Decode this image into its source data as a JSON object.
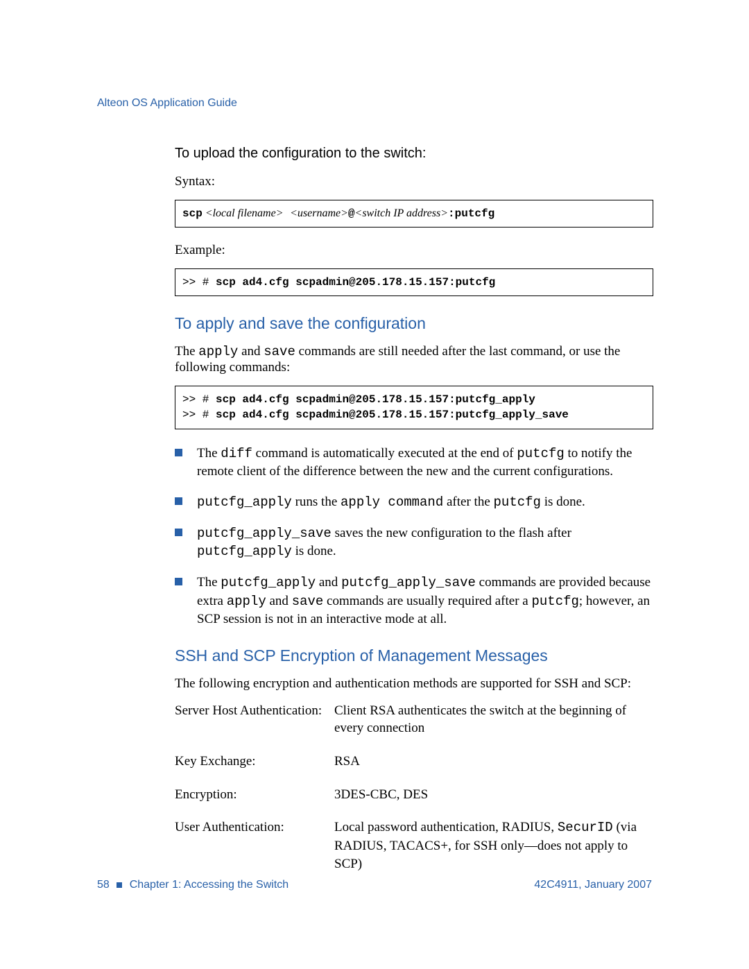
{
  "header": {
    "title": "Alteon OS Application Guide"
  },
  "main": {
    "step_title": "To upload the configuration to the switch:",
    "syntax_label": "Syntax:",
    "syntax_box": {
      "cmd": "scp",
      "param_local": " <local filename>",
      "sep1": " ",
      "param_user": "<username>",
      "at": "@",
      "param_ip": "<switch IP address>",
      "suffix": ":putcfg"
    },
    "example_label": "Example:",
    "example_box": {
      "prompt": ">> # ",
      "line": "scp ad4.cfg scpadmin@205.178.15.157:putcfg"
    },
    "apply_heading": "To apply and save the configuration",
    "apply_intro_a": "The ",
    "apply_intro_cmd1": "apply",
    "apply_intro_b": " and ",
    "apply_intro_cmd2": "save",
    "apply_intro_c": " commands are still needed after the last command, or use the following commands:",
    "apply_box": {
      "p1": ">> # ",
      "l1": "scp ad4.cfg scpadmin@205.178.15.157:putcfg_apply",
      "p2": ">> # ",
      "l2": "scp ad4.cfg scpadmin@205.178.15.157:putcfg_apply_save"
    },
    "bullets": {
      "b1_a": "The ",
      "b1_m1": "diff",
      "b1_b": " command is automatically executed at the end of ",
      "b1_m2": "putcfg",
      "b1_c": " to notify the remote client of the difference between the new and the current configurations.",
      "b2_m1": "putcfg_apply",
      "b2_a": " runs the ",
      "b2_m2": "apply command",
      "b2_b": " after the ",
      "b2_m3": "putcfg",
      "b2_c": " is done.",
      "b3_m1": "putcfg_apply_save",
      "b3_a": " saves the new configuration to the flash after ",
      "b3_m2": "putcfg_apply",
      "b3_b": " is done.",
      "b4_a": "The ",
      "b4_m1": "putcfg_apply",
      "b4_b": " and ",
      "b4_m2": "putcfg_apply_save",
      "b4_c": " commands are provided because extra ",
      "b4_m3": "apply",
      "b4_d": " and ",
      "b4_m4": "save",
      "b4_e": " commands are usually required after a ",
      "b4_m5": "putcfg",
      "b4_f": "; however, an SCP session is not in an interactive mode at all."
    },
    "ssh_heading": "SSH and SCP Encryption of Management Messages",
    "ssh_intro": "The following encryption and authentication methods are supported for SSH and SCP:",
    "defs": {
      "r1_term": "Server Host Authentication:",
      "r1_def": "Client RSA authenticates the switch at the beginning of every connection",
      "r2_term": "Key Exchange:",
      "r2_def": "RSA",
      "r3_term": "Encryption:",
      "r3_def": "3DES-CBC, DES",
      "r4_term": "User Authentication:",
      "r4_def_a": "Local password authentication, RADIUS, ",
      "r4_def_m": "SecurID",
      "r4_def_b": " (via RADIUS, TACACS+, for SSH only—does not apply to SCP)"
    }
  },
  "footer": {
    "page": "58",
    "chapter": "Chapter 1: Accessing the Switch",
    "docref": "42C4911, January 2007"
  }
}
